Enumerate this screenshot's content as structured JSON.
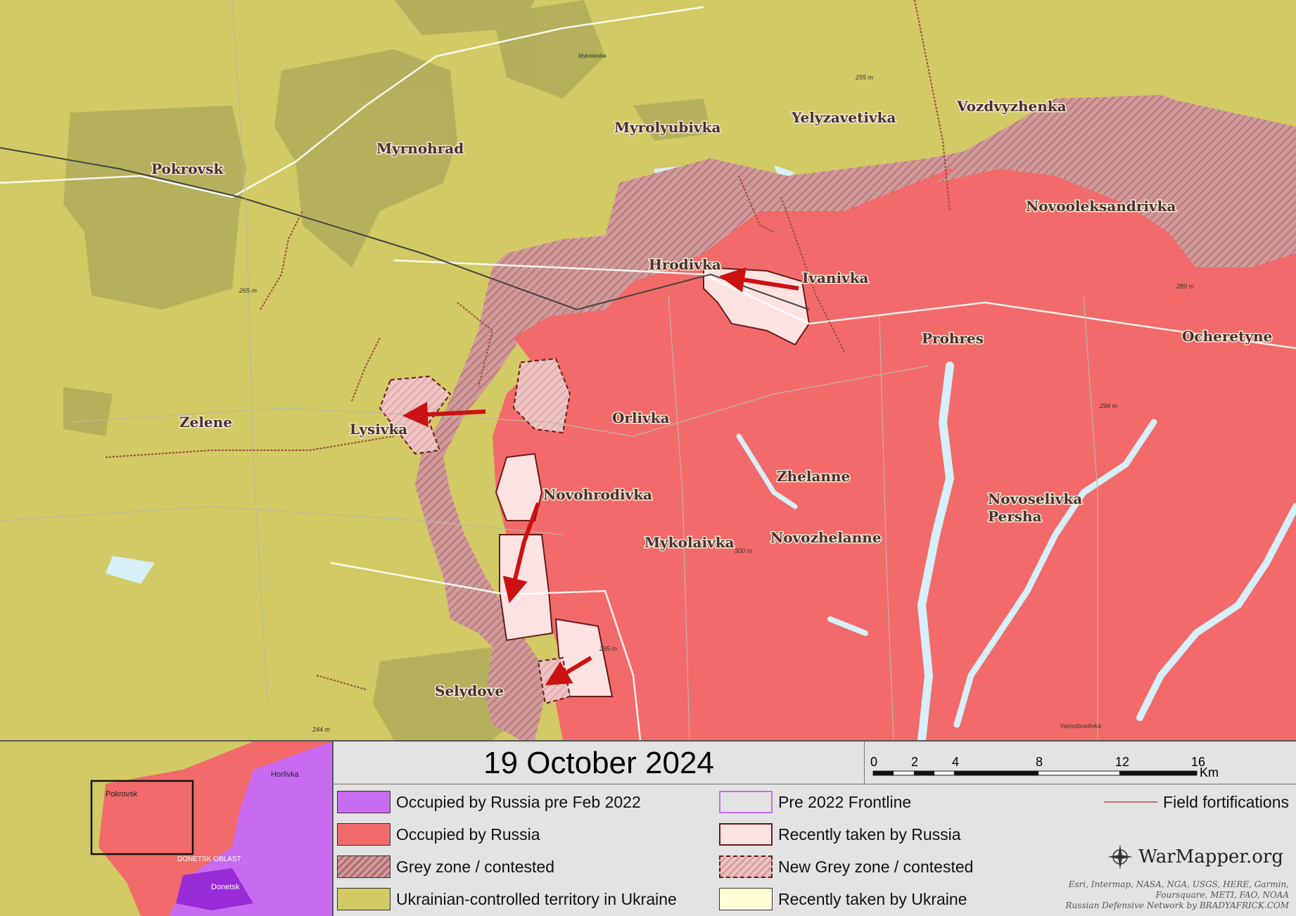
{
  "date": "19 October 2024",
  "colors": {
    "ukraine": "#d2ca64",
    "ukraine_urban": "#b3ae5c",
    "russia": "#f26a6a",
    "russia_pre2022": "#c86bf0",
    "grey_zone": "#d49a9a",
    "recent_russia": "#fde2e2",
    "recent_ukraine": "#ffffd6",
    "water": "#d6eff8",
    "advance_arrow": "#cc1111"
  },
  "places": {
    "pokrovsk": "Pokrovsk",
    "myrnohrad": "Myrnohrad",
    "myrolyubivka": "Myrolyubivka",
    "yelyzavetivka": "Yelyzavetivka",
    "vozdvyzhenka": "Vozdvyzhenka",
    "novooleksandrivka": "Novooleksandrivka",
    "hrodivka": "Hrodivka",
    "ivanivka": "Ivanivka",
    "prohres": "Prohres",
    "ocheretyne": "Ocheretyne",
    "lysivka": "Lysivka",
    "zelene": "Zelene",
    "orlivka": "Orlivka",
    "zhelanne": "Zhelanne",
    "novohrodivka": "Novohrodivka",
    "mykolaivka": "Mykolaivka",
    "novozhelanne": "Novozhelanne",
    "novoselivka_persha_1": "Novoselivka",
    "novoselivka_persha_2": "Persha",
    "selydove": "Selydove"
  },
  "small_labels": {
    "mykolaivka_top": "Mykolaivka",
    "yasnobrodivka": "Yasnobrodivka",
    "elev_255": "255 m",
    "elev_265": "265 m",
    "elev_289": "289 m",
    "elev_294": "294 m",
    "elev_300": "300 m",
    "elev_295": "295 m",
    "elev_244": "244 m"
  },
  "inset": {
    "pokrovsk": "Pokrovsk",
    "horlivka": "Horlivka",
    "oblast": "DONETSK OBLAST",
    "donetsk": "Donetsk"
  },
  "scale": {
    "ticks": [
      "0",
      "2",
      "4",
      "8",
      "12",
      "16"
    ],
    "unit": "Km"
  },
  "legend": {
    "left": [
      {
        "label": "Occupied by Russia pre Feb 2022",
        "style": "purple"
      },
      {
        "label": "Occupied by Russia",
        "style": "red"
      },
      {
        "label": "Grey zone / contested",
        "style": "grey-hatch"
      },
      {
        "label": "Ukrainian-controlled territory in Ukraine",
        "style": "olive"
      }
    ],
    "right": [
      {
        "label": "Pre 2022 Frontline",
        "style": "purple-outline"
      },
      {
        "label": "Recently taken by Russia",
        "style": "pink-outline"
      },
      {
        "label": "New Grey zone / contested",
        "style": "pink-dashed"
      },
      {
        "label": "Recently taken by Ukraine",
        "style": "cream"
      }
    ],
    "field_fortifications": "Field fortifications"
  },
  "brand": "WarMapper.org",
  "credits": [
    "Esri, Intermap, NASA, NGA, USGS, HERE, Garmin,",
    "Foursquare, METI, FAO, NOAA",
    "Russian Defensive Network by BRADYAFRICK.COM"
  ]
}
